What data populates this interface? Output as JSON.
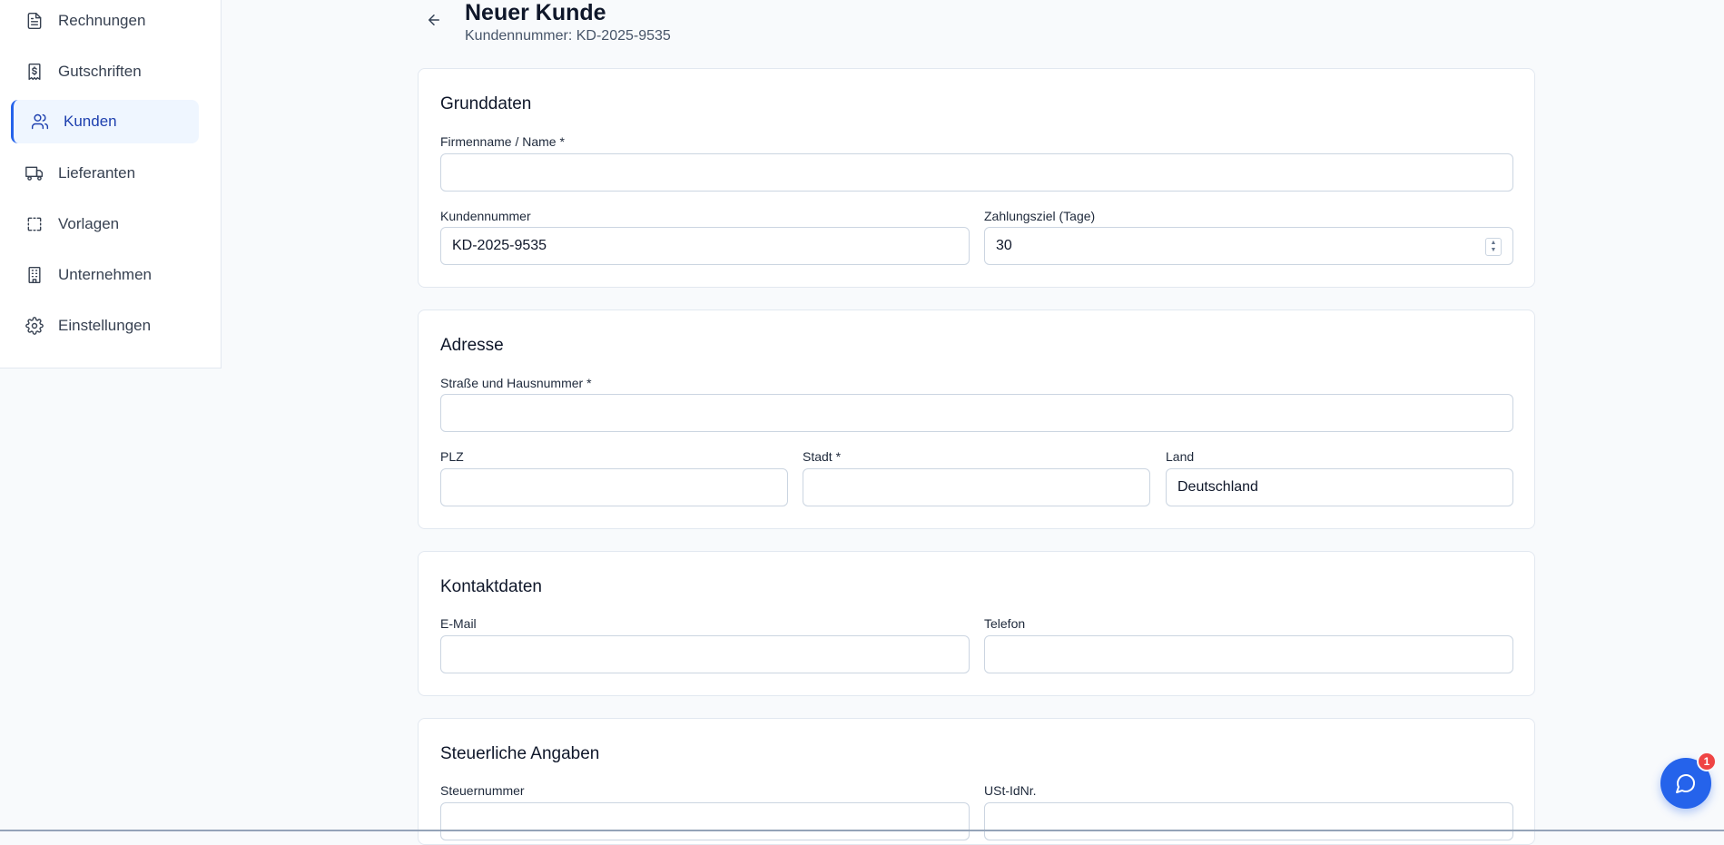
{
  "sidebar": {
    "items": [
      {
        "label": "Rechnungen",
        "icon": "file-text-icon"
      },
      {
        "label": "Gutschriften",
        "icon": "receipt-dollar-icon"
      },
      {
        "label": "Kunden",
        "icon": "users-icon",
        "active": true
      },
      {
        "label": "Lieferanten",
        "icon": "truck-icon"
      },
      {
        "label": "Vorlagen",
        "icon": "dashed-square-icon"
      },
      {
        "label": "Unternehmen",
        "icon": "building-icon"
      },
      {
        "label": "Einstellungen",
        "icon": "gear-icon"
      }
    ]
  },
  "header": {
    "title": "Neuer Kunde",
    "subtitle": "Kundennummer: KD-2025-9535"
  },
  "grunddaten": {
    "title": "Grunddaten",
    "firmenname_label": "Firmenname / Name *",
    "firmenname_value": "",
    "kundennummer_label": "Kundennummer",
    "kundennummer_value": "KD-2025-9535",
    "zahlungsziel_label": "Zahlungsziel (Tage)",
    "zahlungsziel_value": "30"
  },
  "adresse": {
    "title": "Adresse",
    "strasse_label": "Straße und Hausnummer *",
    "strasse_value": "",
    "plz_label": "PLZ",
    "plz_value": "",
    "stadt_label": "Stadt *",
    "stadt_value": "",
    "land_label": "Land",
    "land_value": "Deutschland"
  },
  "kontakt": {
    "title": "Kontaktdaten",
    "email_label": "E-Mail",
    "email_value": "",
    "telefon_label": "Telefon",
    "telefon_value": ""
  },
  "steuer": {
    "title": "Steuerliche Angaben",
    "steuernummer_label": "Steuernummer",
    "ustid_label": "USt-IdNr."
  },
  "chat": {
    "badge": "1",
    "icon": "chat-bubble-icon"
  },
  "colors": {
    "accent": "#2563eb",
    "active_bg": "#eff6ff",
    "badge": "#ef4444"
  }
}
